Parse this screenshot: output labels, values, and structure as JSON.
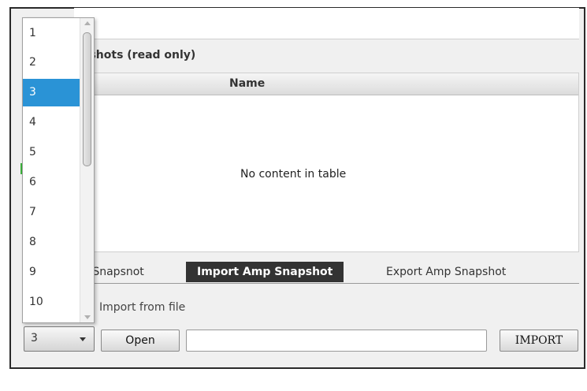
{
  "dropdown": {
    "options": [
      "1",
      "2",
      "3",
      "4",
      "5",
      "6",
      "7",
      "8",
      "9",
      "10"
    ],
    "selected_index": 2,
    "selected_value": "3"
  },
  "snapshots": {
    "title": "apshots (read only)",
    "column_name": "Name",
    "empty_message": "No content in table"
  },
  "tabs": [
    {
      "label": "p Snapsnot",
      "active": false
    },
    {
      "label": "Import Amp Snapshot",
      "active": true
    },
    {
      "label": "Export Amp Snapshot",
      "active": false
    }
  ],
  "import": {
    "label": "Import from file",
    "open_button": "Open",
    "path_value": "",
    "import_button": "IMPORT"
  },
  "colors": {
    "selection": "#2a93d6",
    "active_tab": "#333333"
  },
  "icons": {
    "combo_arrow": "chevron-down-icon",
    "scroll_up": "scroll-up-arrow-icon",
    "scroll_down": "scroll-down-arrow-icon"
  }
}
